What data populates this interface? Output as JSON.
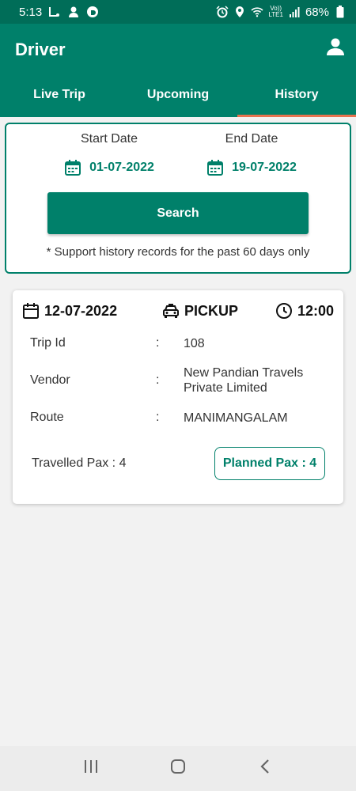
{
  "status_bar": {
    "time": "5:13",
    "battery": "68%",
    "network_label": "Vo))\nLTE1",
    "icons": [
      "notification-icon",
      "avatar-icon",
      "app-icon",
      "alarm-icon",
      "location-icon",
      "wifi-icon",
      "signal-icon",
      "battery-icon"
    ]
  },
  "app_bar": {
    "title": "Driver",
    "profile_icon": "person-icon"
  },
  "tabs": [
    {
      "label": "Live Trip",
      "active": false
    },
    {
      "label": "Upcoming",
      "active": false
    },
    {
      "label": "History",
      "active": true
    }
  ],
  "filter": {
    "start_label": "Start Date",
    "start_value": "01-07-2022",
    "end_label": "End Date",
    "end_value": "19-07-2022",
    "search_label": "Search",
    "note": "* Support history records for the past 60 days only"
  },
  "trip": {
    "date": "12-07-2022",
    "type": "PICKUP",
    "time": "12:00",
    "rows": [
      {
        "label": "Trip Id",
        "colon": ":",
        "value": "108"
      },
      {
        "label": "Vendor",
        "colon": ":",
        "value": "New Pandian Travels Private Limited"
      },
      {
        "label": "Route",
        "colon": ":",
        "value": "MANIMANGALAM"
      }
    ],
    "travelled_pax": "Travelled Pax  :  4",
    "planned_pax": "Planned Pax  :  4"
  },
  "colors": {
    "primary": "#00806a",
    "status_bar": "#006d58",
    "tab_indicator": "#e8734f"
  }
}
